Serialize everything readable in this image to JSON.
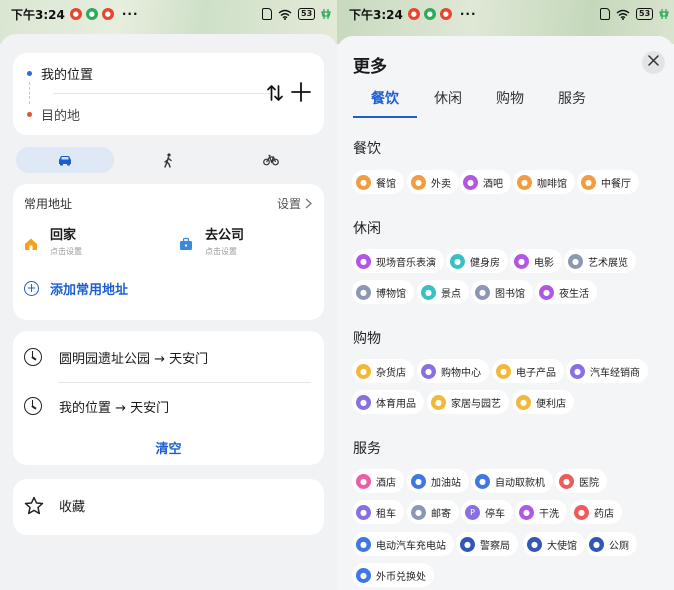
{
  "left": {
    "status": {
      "time": "下午3:24",
      "battery": "53"
    },
    "route": {
      "origin": "我的位置",
      "destination": "目的地"
    },
    "modes": [
      {
        "name": "drive",
        "icon": "car-icon",
        "active": true
      },
      {
        "name": "walk",
        "icon": "walk-icon",
        "active": false
      },
      {
        "name": "bike",
        "icon": "bike-icon",
        "active": false
      }
    ],
    "common": {
      "title": "常用地址",
      "settings_label": "设置",
      "home": {
        "label": "回家",
        "sub": "点击设置"
      },
      "work": {
        "label": "去公司",
        "sub": "点击设置"
      },
      "add_label": "添加常用地址"
    },
    "history": {
      "items": [
        "圆明园遗址公园 → 天安门",
        "我的位置 → 天安门"
      ],
      "clear_label": "清空"
    },
    "favorites_label": "收藏"
  },
  "right": {
    "status": {
      "time": "下午3:24",
      "battery": "53"
    },
    "title": "更多",
    "close_icon": "close-icon",
    "tabs": [
      "餐饮",
      "休闲",
      "购物",
      "服务"
    ],
    "active_tab": "餐饮",
    "sections": [
      {
        "title": "餐饮",
        "items": [
          "餐馆",
          "外卖",
          "酒吧",
          "咖啡馆",
          "中餐厅"
        ]
      },
      {
        "title": "休闲",
        "items": [
          "现场音乐表演",
          "健身房",
          "电影",
          "艺术展览",
          "博物馆",
          "景点",
          "图书馆",
          "夜生活"
        ]
      },
      {
        "title": "购物",
        "items": [
          "杂货店",
          "购物中心",
          "电子产品",
          "汽车经销商",
          "体育用品",
          "家居与园艺",
          "便利店"
        ]
      },
      {
        "title": "服务",
        "items": [
          "酒店",
          "加油站",
          "自动取款机",
          "医院",
          "租车",
          "邮寄",
          "停车",
          "干洗",
          "药店",
          "电动汽车充电站",
          "警察局",
          "大使馆",
          "公厕",
          "外币兑换处"
        ]
      }
    ]
  },
  "colors": {
    "accent": "#1e5fcf",
    "active_tab_bg": "#dfe8f5",
    "background": "#f1f2f4"
  }
}
